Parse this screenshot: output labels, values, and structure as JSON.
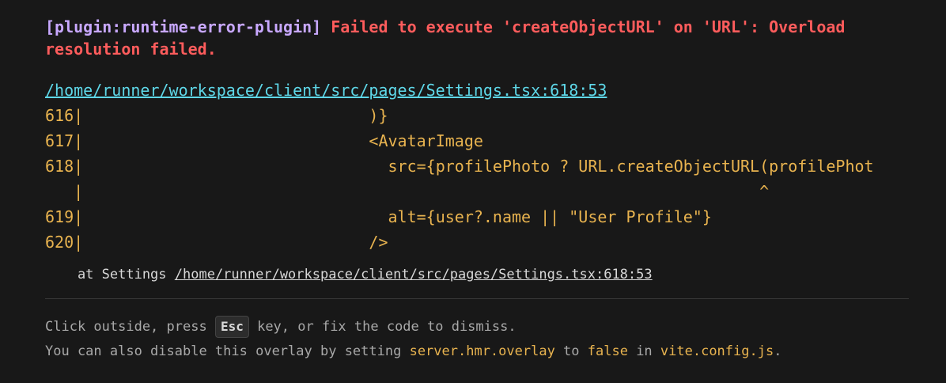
{
  "error": {
    "plugin": "[plugin:runtime-error-plugin]",
    "message": "Failed to execute 'createObjectURL' on 'URL': Overload resolution failed."
  },
  "file_link": "/home/runner/workspace/client/src/pages/Settings.tsx:618:53",
  "frame": [
    {
      "ln": "616|",
      "code": "                              )}"
    },
    {
      "ln": "617|",
      "code": "                              <AvatarImage"
    },
    {
      "ln": "618|",
      "code": "                                src={profilePhoto ? URL.createObjectURL(profilePhot"
    },
    {
      "ln": "   |",
      "code": "                                                                       ^"
    },
    {
      "ln": "619|",
      "code": "                                alt={user?.name || \"User Profile\"}"
    },
    {
      "ln": "620|",
      "code": "                              />"
    }
  ],
  "stack": {
    "prefix": "    at Settings ",
    "link": "/home/runner/workspace/client/src/pages/Settings.tsx:618:53"
  },
  "tip": {
    "line1_before": "Click outside, press ",
    "esc_key": "Esc",
    "line1_after": " key, or fix the code to dismiss.",
    "line2_a": "You can also disable this overlay by setting ",
    "line2_config": "server.hmr.overlay",
    "line2_b": " to ",
    "line2_false": "false",
    "line2_c": " in ",
    "line2_file": "vite.config.js",
    "line2_d": "."
  }
}
